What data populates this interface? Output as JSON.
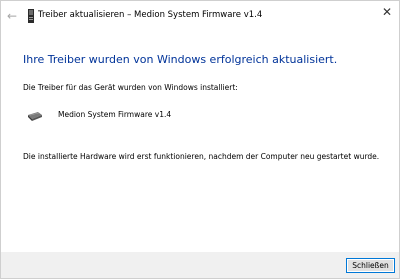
{
  "window": {
    "title": "Treiber aktualisieren – Medion System Firmware v1.4",
    "back_icon": "arrow-left",
    "close_icon": "close-x"
  },
  "content": {
    "heading": "Ihre Treiber wurden von Windows erfolgreich aktualisiert.",
    "intro": "Die Treiber für das Gerät wurden von Windows installiert:",
    "device_name": "Medion System Firmware v1.4",
    "restart_note": "Die installierte Hardware wird erst funktionieren, nachdem der Computer neu gestartet wurde."
  },
  "footer": {
    "close_button_label": "Schließen"
  },
  "colors": {
    "heading": "#003399",
    "button_border": "#0078d7",
    "footer_background": "#f0f0f0"
  }
}
